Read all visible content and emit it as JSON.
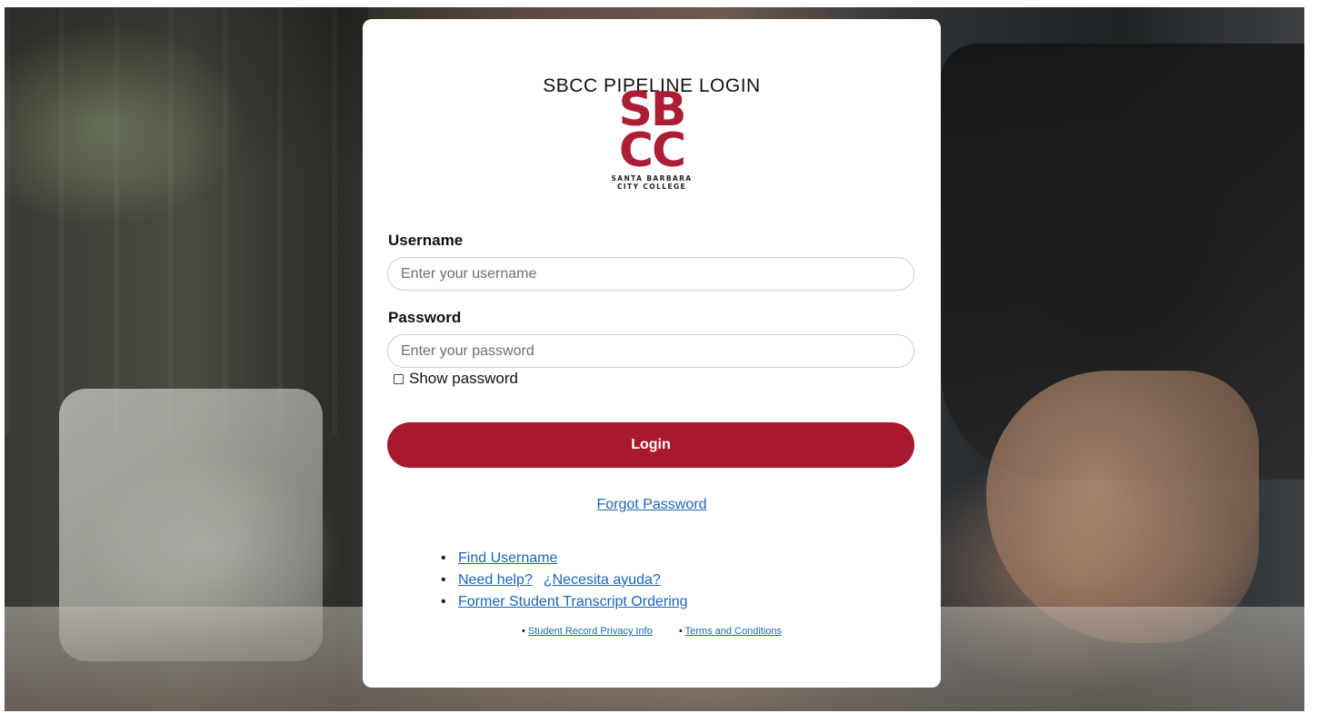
{
  "login": {
    "title": "SBCC PIPELINE LOGIN",
    "logo": {
      "line1": "SB",
      "line2": "CC",
      "sub1": "SANTA BARBARA",
      "sub2": "CITY COLLEGE"
    },
    "username": {
      "label": "Username",
      "placeholder": "Enter your username",
      "value": ""
    },
    "password": {
      "label": "Password",
      "placeholder": "Enter your password",
      "value": ""
    },
    "show_password": {
      "label": "Show password",
      "checked": false
    },
    "login_button": "Login",
    "forgot_password": "Forgot Password",
    "help_links": {
      "find_username": "Find Username",
      "need_help": "Need help?",
      "necesita_ayuda": "¿Necesita ayuda?",
      "transcript": "Former Student Transcript Ordering"
    },
    "footer_links": {
      "privacy": "Student Record Privacy Info",
      "terms": "Terms and Conditions"
    }
  },
  "colors": {
    "brand_red": "#a8192e",
    "link_blue": "#1a66b8",
    "input_border": "#c9ced6"
  },
  "icons": {
    "bullet": "•",
    "checkbox": "unchecked-box"
  }
}
